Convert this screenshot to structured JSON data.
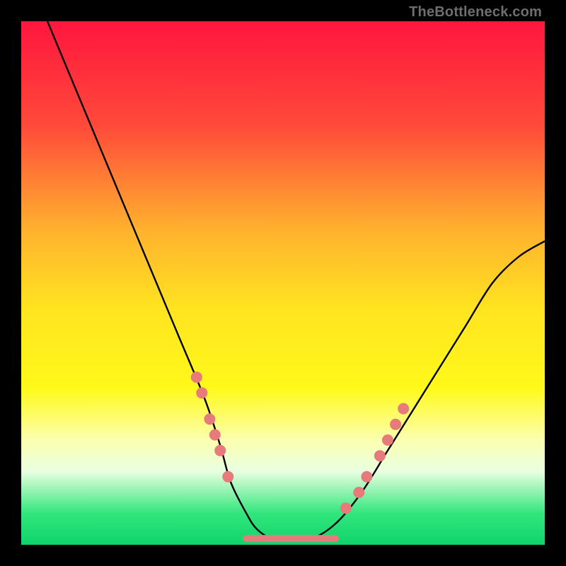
{
  "watermark": {
    "text": "TheBottleneck.com"
  },
  "gradient": {
    "stops": [
      {
        "offset": 0.0,
        "color": "#ff163e"
      },
      {
        "offset": 0.2,
        "color": "#ff4a3a"
      },
      {
        "offset": 0.4,
        "color": "#ffb22e"
      },
      {
        "offset": 0.55,
        "color": "#ffe420"
      },
      {
        "offset": 0.7,
        "color": "#fff91a"
      },
      {
        "offset": 0.8,
        "color": "#fcffb0"
      },
      {
        "offset": 0.86,
        "color": "#e8ffe0"
      },
      {
        "offset": 0.94,
        "color": "#32e67c"
      },
      {
        "offset": 1.0,
        "color": "#0fd46b"
      }
    ]
  },
  "chart_data": {
    "type": "line",
    "title": "",
    "xlabel": "",
    "ylabel": "",
    "xlim": [
      0,
      100
    ],
    "ylim": [
      0,
      100
    ],
    "series": [
      {
        "name": "bottleneck-curve",
        "x": [
          5,
          10,
          15,
          20,
          25,
          30,
          35,
          38,
          40,
          43,
          45,
          48,
          50,
          55,
          60,
          65,
          70,
          75,
          80,
          85,
          90,
          95,
          100
        ],
        "values": [
          100,
          88,
          76,
          64,
          52,
          40,
          28,
          19,
          12,
          6,
          3,
          1,
          1,
          1,
          4,
          10,
          18,
          26,
          34,
          42,
          50,
          55,
          58
        ]
      }
    ],
    "markers": {
      "name": "highlight-dots",
      "color": "#e77a7a",
      "radius": 8,
      "points": [
        {
          "x": 33.5,
          "y": 32
        },
        {
          "x": 34.5,
          "y": 29
        },
        {
          "x": 36.0,
          "y": 24
        },
        {
          "x": 37.0,
          "y": 21
        },
        {
          "x": 38.0,
          "y": 18
        },
        {
          "x": 39.5,
          "y": 13
        },
        {
          "x": 62.0,
          "y": 7
        },
        {
          "x": 64.5,
          "y": 10
        },
        {
          "x": 66.0,
          "y": 13
        },
        {
          "x": 68.5,
          "y": 17
        },
        {
          "x": 70.0,
          "y": 20
        },
        {
          "x": 71.5,
          "y": 23
        },
        {
          "x": 73.0,
          "y": 26
        }
      ]
    },
    "flat_band": {
      "name": "valley-band",
      "color": "#e77a7a",
      "y": 1.2,
      "x_start": 43,
      "x_end": 60,
      "thickness": 10
    }
  }
}
